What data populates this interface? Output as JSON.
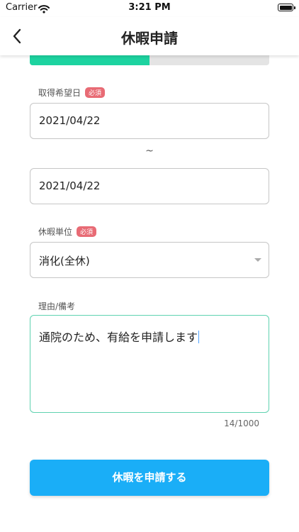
{
  "status_bar": {
    "carrier": "Carrier",
    "time": "3:21 PM"
  },
  "header": {
    "title": "休暇申請",
    "back_icon": "chevron-left-icon"
  },
  "progress": {
    "value": 0.5,
    "color": "#1dd3a0"
  },
  "form": {
    "date": {
      "label": "取得希望日",
      "required_badge": "必須",
      "start": "2021/04/22",
      "separator": "~",
      "end": "2021/04/22"
    },
    "unit": {
      "label": "休暇単位",
      "required_badge": "必須",
      "selected": "消化(全休)",
      "icon": "dropdown-arrow-icon"
    },
    "reason": {
      "label": "理由/備考",
      "value": "通院のため、有給を申請します",
      "counter": "14/1000"
    }
  },
  "submit": {
    "label": "休暇を申請する",
    "color": "#1aaef7"
  }
}
